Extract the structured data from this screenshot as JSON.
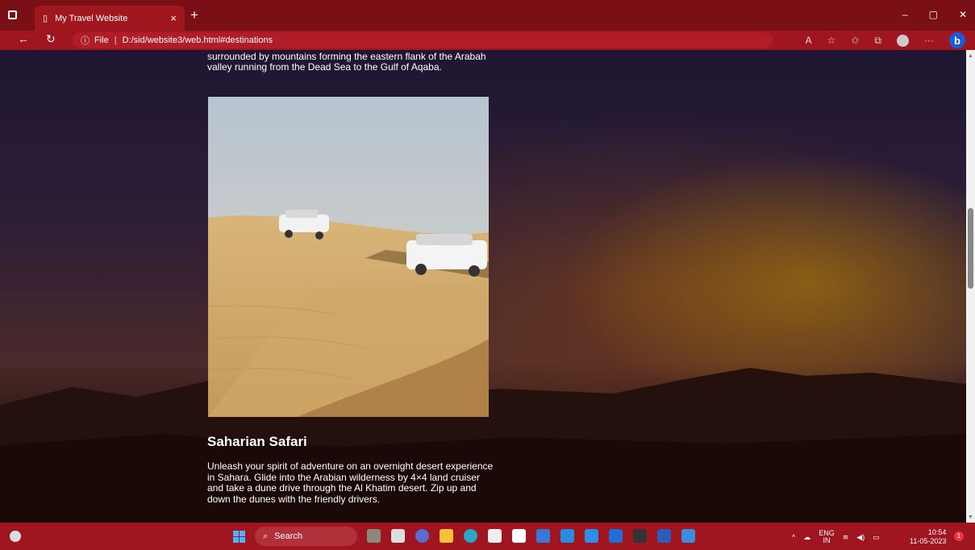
{
  "browser": {
    "tab_title": "My Travel Website",
    "tab_close": "×",
    "new_tab": "+",
    "url_prefix": "File",
    "url_separator": "|",
    "url": "D:/sid/website3/web.html#destinations",
    "window_controls": [
      "–",
      "▢",
      "✕"
    ]
  },
  "page": {
    "intro_text": "surrounded by mountains forming the eastern flank of the Arabah valley running from the Dead Sea to the Gulf of Aqaba.",
    "section_heading": "Saharian Safari",
    "section_text": "Unleash your spirit of adventure on an overnight desert experience in Sahara. Glide into the Arabian wilderness by 4×4 land cruiser and take a dune drive through the Al Khatim desert. Zip up and down the dunes with the friendly drivers."
  },
  "taskbar": {
    "search_label": "Search",
    "lang_line1": "ENG",
    "lang_line2": "IN",
    "time": "10:54",
    "date": "11-05-2023",
    "notification_count": "1"
  },
  "colors": {
    "chrome_dark": "#7a0f16",
    "chrome": "#9f1620"
  },
  "icons": [
    "window-icon",
    "page-icon",
    "back-icon",
    "refresh-icon",
    "info-icon",
    "read-aloud-icon",
    "favorites-add-icon",
    "favorites-icon",
    "collections-icon",
    "profile-icon",
    "more-icon",
    "bing-icon",
    "weather-icon",
    "start-icon",
    "search-icon",
    "wifi-icon",
    "volume-icon",
    "battery-icon"
  ]
}
